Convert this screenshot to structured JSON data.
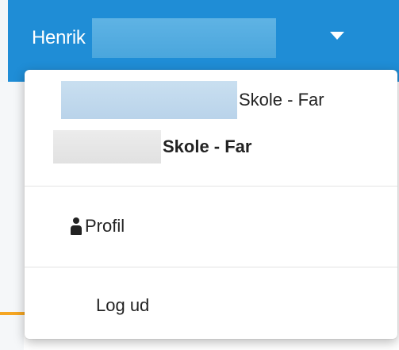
{
  "header": {
    "user_name": "Henrik",
    "toggle_icon": "caret-down-icon",
    "color": "#1f8dd6"
  },
  "dropdown": {
    "schools": [
      {
        "label": "Skole - Far",
        "active": false
      },
      {
        "label": "Skole - Far",
        "active": true
      }
    ],
    "profile": {
      "label": "Profil",
      "icon": "person-icon"
    },
    "logout": {
      "label": "Log ud"
    }
  }
}
